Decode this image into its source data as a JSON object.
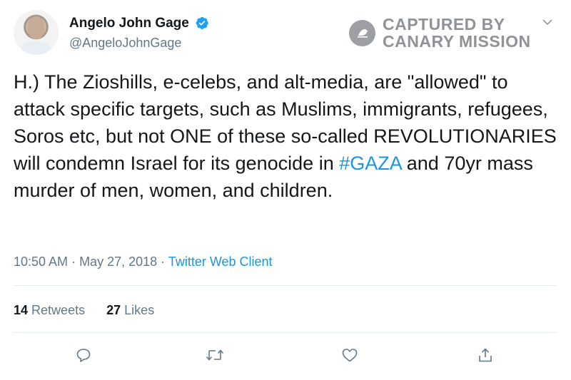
{
  "author": {
    "name": "Angelo John Gage",
    "handle": "@AngeloJohnGage",
    "verified_icon": "verified-badge-icon",
    "verified_color": "#1da1f2"
  },
  "watermark": {
    "line1": "CAPTURED BY",
    "line2": "CANARY MISSION",
    "color": "#8f9296"
  },
  "tweet": {
    "text_before": "H.) The Zioshills, e-celebs, and alt-media, are \"allowed\" to attack specific targets, such as Muslims, immigrants, refugees, Soros etc, but not ONE of these so-called REVOLUTIONARIES will condemn Israel for its genocide in ",
    "hashtag": "#GAZA",
    "text_after": " and 70yr mass murder of men, women, and children.",
    "hashtag_color": "#1b95e0"
  },
  "meta": {
    "time": "10:50 AM",
    "sep1": " · ",
    "date": "May 27, 2018",
    "sep2": " · ",
    "client": "Twitter Web Client"
  },
  "stats": {
    "retweets_count": "14",
    "retweets_label": "Retweets",
    "likes_count": "27",
    "likes_label": "Likes"
  },
  "actions": [
    "reply-icon",
    "retweet-icon",
    "like-icon",
    "share-icon"
  ],
  "colors": {
    "text": "#14171a",
    "secondary": "#657786",
    "link": "#1b95e0",
    "divider": "#e6ecf0"
  }
}
